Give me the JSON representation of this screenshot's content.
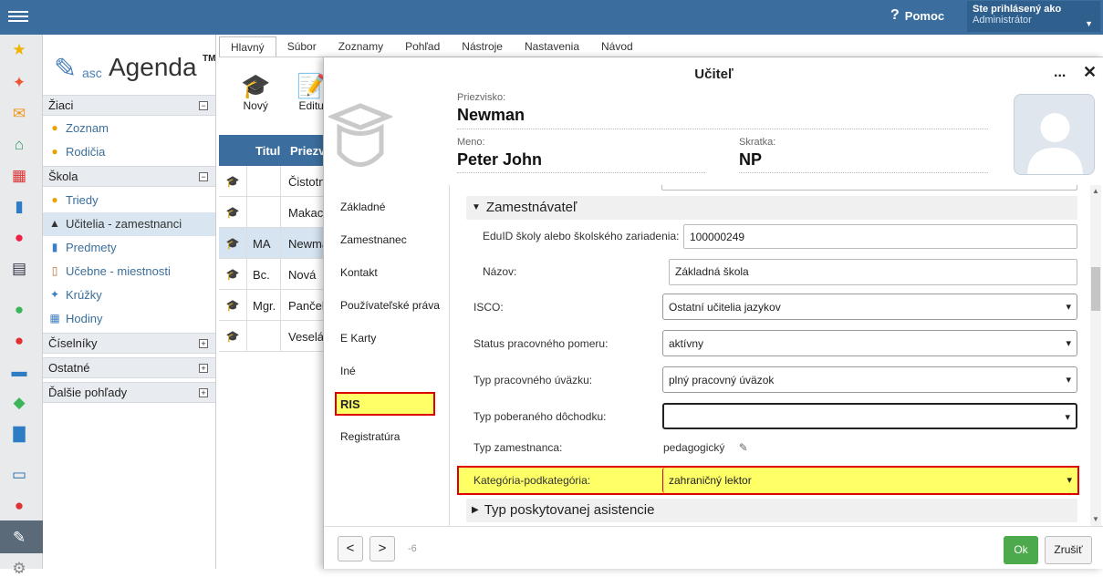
{
  "topbar": {
    "help_label": "Pomoc",
    "user_line1": "Ste prihlásený ako",
    "user_line2": "Administrátor"
  },
  "colors": {
    "topbar": "#3b6e9e",
    "ok_green": "#4caa4c",
    "highlight_yellow": "#ffff66",
    "highlight_red": "#dd0000"
  },
  "leftbar_icons": [
    "star-icon",
    "magic-wand-icon",
    "mail-icon",
    "home-icon",
    "calendar-grid-icon",
    "book-icon",
    "user-circle-icon",
    "schedule-icon",
    "check-circle-icon",
    "award-icon",
    "briefcase-icon",
    "shield-check-icon",
    "bar-chart-icon",
    "open-book-icon",
    "chat-icon",
    "pen-icon",
    "gear-icon"
  ],
  "logo": {
    "small": "asc",
    "big": "Agenda",
    "tm": "TM"
  },
  "nav": {
    "zaci": "Žiaci",
    "zoznam": "Zoznam",
    "rodicia": "Rodičia",
    "skola": "Škola",
    "triedy": "Triedy",
    "ucitelia": "Učitelia - zamestnanci",
    "predmety": "Predmety",
    "ucebne": "Učebne - miestnosti",
    "kruzky": "Krúžky",
    "hodiny": "Hodiny",
    "ciselniky": "Číselníky",
    "ostatne": "Ostatné",
    "dalsie": "Ďalšie pohľady"
  },
  "main_tabs": [
    "Hlavný",
    "Súbor",
    "Zoznamy",
    "Pohľad",
    "Nástroje",
    "Nastavenia",
    "Návod"
  ],
  "toolbar": {
    "new": "Nový",
    "edit": "Editu"
  },
  "grid": {
    "col_titul": "Titul",
    "col_priezvisko": "Priezv",
    "rows": [
      {
        "titul": "",
        "priezvisko": "Čistotn"
      },
      {
        "titul": "",
        "priezvisko": "Makac"
      },
      {
        "titul": "MA",
        "priezvisko": "Newma"
      },
      {
        "titul": "Bc.",
        "priezvisko": "Nová"
      },
      {
        "titul": "Mgr.",
        "priezvisko": "Pančel"
      },
      {
        "titul": "",
        "priezvisko": "Veselá"
      }
    ]
  },
  "dialog": {
    "title": "Učiteľ",
    "dots": "...",
    "priezvisko_label": "Priezvisko:",
    "priezvisko": "Newman",
    "meno_label": "Meno:",
    "meno": "Peter John",
    "skratka_label": "Skratka:",
    "skratka": "NP",
    "side": [
      "Základné",
      "Zamestnanec",
      "Kontakt",
      "Používateľské práva",
      "E Karty",
      "Iné",
      "RIS",
      "Registratúra"
    ],
    "section_zamestnavatel": "Zamestnávateľ",
    "edu_label": "EduID školy alebo školského zariadenia:",
    "edu_value": "100000249",
    "nazov_label": "Názov:",
    "nazov_value": "Základná škola",
    "isco_label": "ISCO:",
    "isco_value": "Ostatní učitelia jazykov",
    "status_label": "Status pracovného pomeru:",
    "status_value": "aktívny",
    "typ_uvazku_label": "Typ pracovného úväzku:",
    "typ_uvazku_value": "plný pracovný úväzok",
    "duchodok_label": "Typ poberaného dôchodku:",
    "duchodok_value": "",
    "typ_zam_label": "Typ zamestnanca:",
    "typ_zam_value": "pedagogický",
    "kategoria_label": "Kategória-podkategória:",
    "kategoria_value": "zahraničný lektor",
    "section_asistencia": "Typ poskytovanej asistencie",
    "page_indicator": "-6",
    "ok": "Ok",
    "cancel": "Zrušiť"
  }
}
